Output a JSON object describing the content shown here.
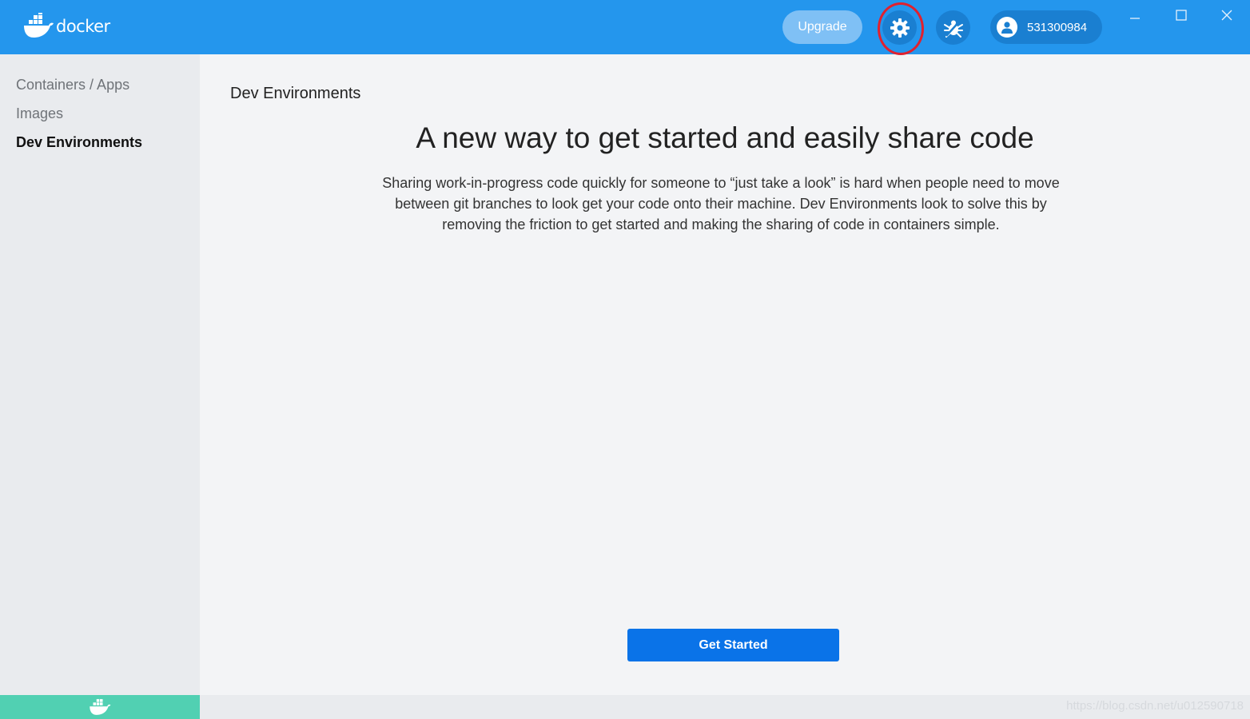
{
  "app": {
    "brand": "docker",
    "accent": "#2496ed"
  },
  "header": {
    "upgrade_label": "Upgrade",
    "settings_icon": "gear-icon",
    "troubleshoot_icon": "bug-icon",
    "account_name": "531300984"
  },
  "sidebar": {
    "items": [
      {
        "label": "Containers / Apps",
        "active": false
      },
      {
        "label": "Images",
        "active": false
      },
      {
        "label": "Dev Environments",
        "active": true
      }
    ]
  },
  "main": {
    "page_title": "Dev Environments",
    "headline": "A new way to get started and easily share code",
    "description": "Sharing work-in-progress code quickly for someone to “just take a look” is hard when people need to move between git branches to look get your code onto their machine. Dev Environments look to solve this by removing the friction to get started and making the sharing of code in containers simple.",
    "cta_label": "Get Started"
  },
  "watermark": "https://blog.csdn.net/u012590718"
}
